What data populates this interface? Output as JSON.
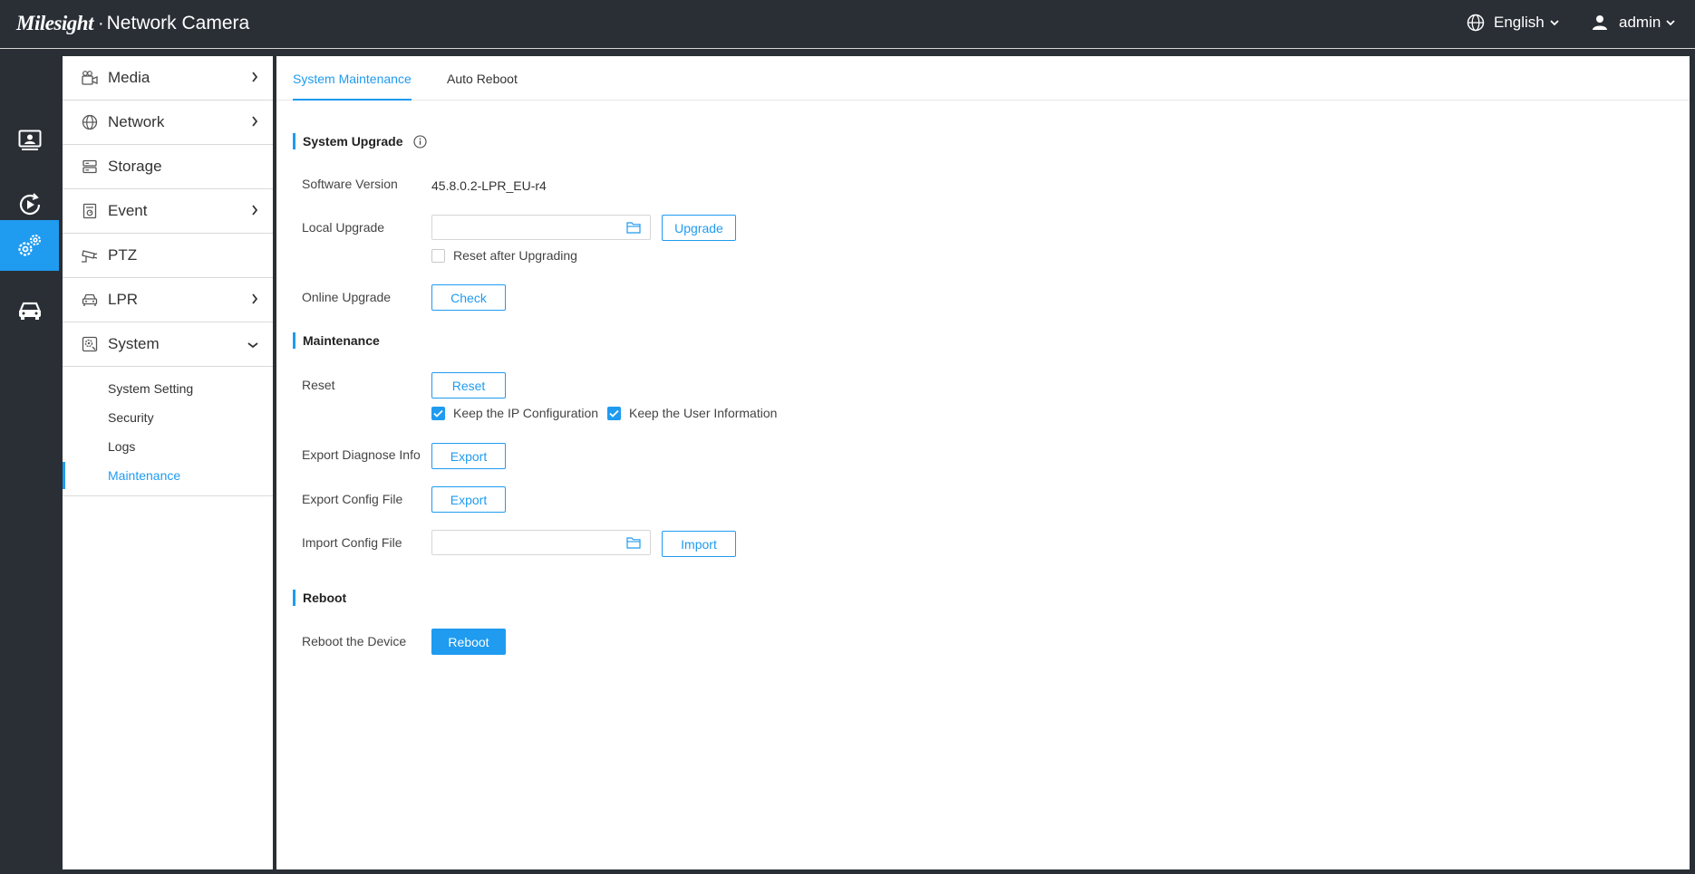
{
  "app": {
    "brand": "Milesight",
    "separator": "·",
    "product": "Network Camera"
  },
  "header": {
    "language": "English",
    "user": "admin"
  },
  "rail": [
    {
      "name": "live-view-icon"
    },
    {
      "name": "playback-icon"
    },
    {
      "name": "settings-icon",
      "active": true
    },
    {
      "name": "vehicle-icon"
    }
  ],
  "sidebar": {
    "items": [
      {
        "label": "Media",
        "icon": "media-icon",
        "expandable": true
      },
      {
        "label": "Network",
        "icon": "globe-icon",
        "expandable": true
      },
      {
        "label": "Storage",
        "icon": "storage-icon",
        "expandable": false
      },
      {
        "label": "Event",
        "icon": "event-icon",
        "expandable": true
      },
      {
        "label": "PTZ",
        "icon": "ptz-icon",
        "expandable": false
      },
      {
        "label": "LPR",
        "icon": "car-icon",
        "expandable": true
      },
      {
        "label": "System",
        "icon": "system-icon",
        "expanded": true
      }
    ],
    "system_sub": [
      {
        "label": "System Setting"
      },
      {
        "label": "Security"
      },
      {
        "label": "Logs"
      },
      {
        "label": "Maintenance",
        "active": true
      }
    ]
  },
  "tabs": [
    {
      "label": "System Maintenance",
      "active": true
    },
    {
      "label": "Auto Reboot"
    }
  ],
  "system_upgrade": {
    "title": "System Upgrade",
    "software_version_label": "Software Version",
    "software_version": "45.8.0.2-LPR_EU-r4",
    "local_upgrade_label": "Local Upgrade",
    "local_upgrade_value": "",
    "upgrade_button": "Upgrade",
    "reset_after_upgrading": "Reset after Upgrading",
    "reset_after_upgrading_checked": false,
    "online_upgrade_label": "Online Upgrade",
    "check_button": "Check"
  },
  "maintenance": {
    "title": "Maintenance",
    "reset_label": "Reset",
    "reset_button": "Reset",
    "keep_ip": "Keep the IP Configuration",
    "keep_ip_checked": true,
    "keep_user": "Keep the User Information",
    "keep_user_checked": true,
    "export_diagnose_label": "Export Diagnose Info",
    "export_diagnose_button": "Export",
    "export_config_label": "Export Config File",
    "export_config_button": "Export",
    "import_config_label": "Import Config File",
    "import_config_value": "",
    "import_button": "Import"
  },
  "reboot": {
    "title": "Reboot",
    "reboot_label": "Reboot the Device",
    "reboot_button": "Reboot"
  },
  "colors": {
    "accent": "#1f9bf0",
    "topbar": "#2a2f36"
  }
}
